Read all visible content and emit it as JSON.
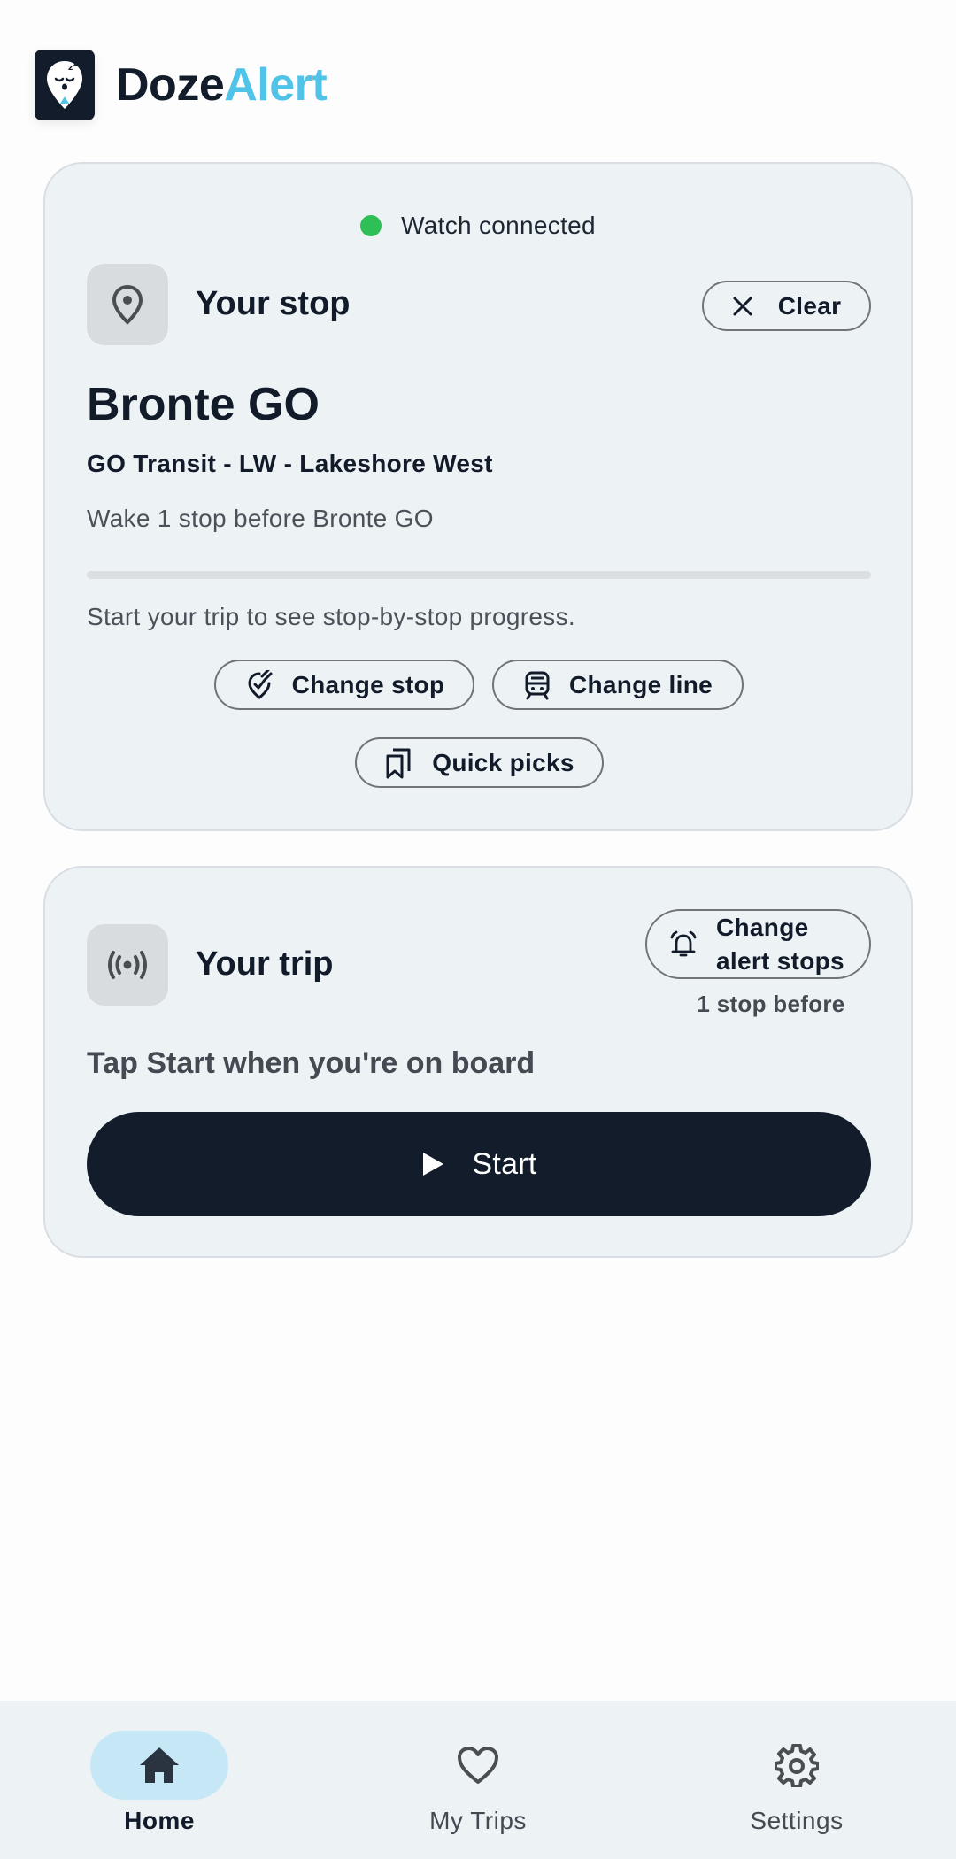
{
  "app": {
    "title_part1": "Doze",
    "title_part2": "Alert",
    "colors": {
      "brand_dark": "#121c2a",
      "brand_accent": "#4fc3e8",
      "connected_green": "#2fbf57"
    }
  },
  "stop_card": {
    "watch_status": "Watch connected",
    "title": "Your stop",
    "icon": "location-pin-icon",
    "clear_label": "Clear",
    "stop_name": "Bronte GO",
    "line_name": "GO Transit - LW - Lakeshore West",
    "wake_text": "Wake 1 stop before Bronte GO",
    "progress": 0,
    "progress_hint": "Start your trip to see stop-by-stop progress.",
    "buttons": {
      "change_stop": "Change stop",
      "change_line": "Change line",
      "quick_picks": "Quick picks"
    }
  },
  "trip_card": {
    "title": "Your trip",
    "icon": "broadcast-icon",
    "change_alert_line1": "Change",
    "change_alert_line2": "alert stops",
    "alert_sub": "1 stop before",
    "hint": "Tap Start when you're on board",
    "start_label": "Start"
  },
  "nav": {
    "items": [
      {
        "label": "Home",
        "icon": "home-icon",
        "active": true
      },
      {
        "label": "My Trips",
        "icon": "heart-icon",
        "active": false
      },
      {
        "label": "Settings",
        "icon": "gear-icon",
        "active": false
      }
    ]
  }
}
